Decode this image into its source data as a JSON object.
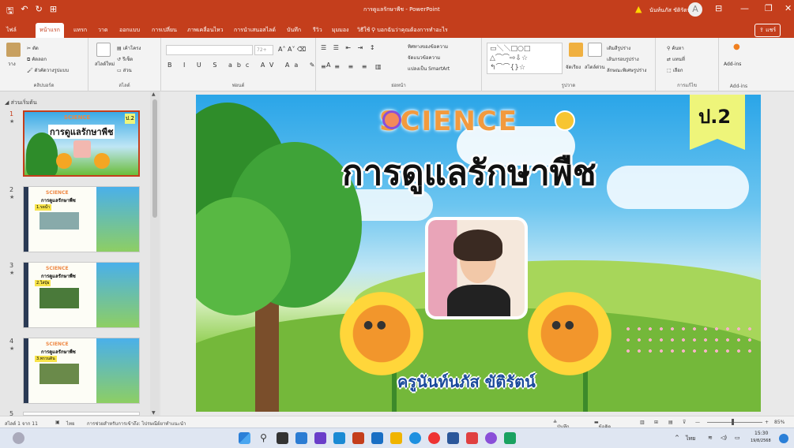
{
  "titlebar": {
    "doc_title": "การดูแลรักษาพืช - PowerPoint",
    "user_name": "นันท์นภัส ขัติรัตน์",
    "warning_icon": "warning-icon",
    "avatar_letter": "A"
  },
  "menubar": {
    "tabs": [
      "ไฟล์",
      "หน้าแรก",
      "แทรก",
      "วาด",
      "ออกแบบ",
      "การเปลี่ยน",
      "ภาพเคลื่อนไหว",
      "การนำเสนอสไลด์",
      "บันทึก",
      "รีวิว",
      "มุมมอง",
      "วิธีใช้"
    ],
    "active_tab": "หน้าแรก",
    "tell_me": "บอกฉันว่าคุณต้องการทำอะไร",
    "share": "แชร์"
  },
  "ribbon": {
    "clipboard": {
      "paste": "วาง",
      "cut": "ตัด",
      "copy": "คัดลอก",
      "format_painter": "ตัวคัดวางรูปแบบ",
      "label": "คลิปบอร์ด"
    },
    "slides": {
      "new_slide": "สไลด์ใหม่",
      "layout": "เค้าโครง",
      "reset": "รีเซ็ต",
      "section": "ส่วน",
      "label": "สไลด์"
    },
    "font": {
      "label": "ฟอนต์",
      "font_size": "72+"
    },
    "paragraph": {
      "label": "ย่อหน้า",
      "text_direction": "ทิศทางของข้อความ",
      "align_text": "จัดแนวข้อความ",
      "smartart": "แปลงเป็น SmartArt"
    },
    "drawing": {
      "label": "รูปวาด",
      "arrange": "จัดเรียง",
      "quick_styles": "สไตล์ด่วน",
      "fill": "เติมสีรูปร่าง",
      "outline": "เส้นกรอบรูปร่าง",
      "effects": "ลักษณะพิเศษรูปร่าง"
    },
    "editing": {
      "label": "การแก้ไข",
      "find": "ค้นหา",
      "replace": "แทนที่",
      "select": "เลือก"
    },
    "addins": {
      "label": "Add-ins",
      "button": "Add-ins"
    }
  },
  "thumbnails": {
    "section_header": "ส่วนเริ่มต้น",
    "slides": [
      {
        "num": "1",
        "title": "การดูแลรักษาพืช",
        "grade": "ป.2"
      },
      {
        "num": "2",
        "title": "การดูแลรักษาพืช",
        "subtitle": "1.รดน้ำ"
      },
      {
        "num": "3",
        "title": "การดูแลรักษาพืช",
        "subtitle": "2.ใส่ปุ๋ย"
      },
      {
        "num": "4",
        "title": "การดูแลรักษาพืช",
        "subtitle": "3.พรวนดิน"
      },
      {
        "num": "5"
      }
    ]
  },
  "slide": {
    "logo_text": "SCIENCE",
    "title": "การดูแลรักษาพืช",
    "grade": "ป.2",
    "teacher": "ครูนันท์นภัส ขัติรัตน์"
  },
  "statusbar": {
    "slide_info": "สไลด์ 1 จาก 11",
    "language": "ไทย",
    "accessibility": "การช่วยสำหรับการเข้าถึง: ไปรษณีย์ยาทำแนะนำ",
    "notes": "บันทึกย่อ",
    "comments": "ข้อคิดเห็น",
    "zoom": "85%"
  },
  "taskbar": {
    "time": "15:30",
    "date": "19/8/2568",
    "lang": "ไทย"
  },
  "colors": {
    "accent": "#c43e1c",
    "ribbon": "#f3f3f3"
  }
}
